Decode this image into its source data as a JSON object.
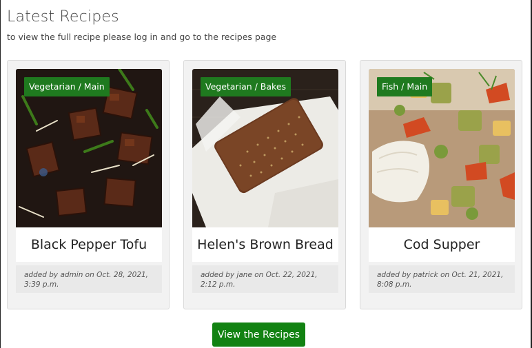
{
  "header": {
    "title": "Latest Recipes",
    "subtitle": "to view the full recipe please log in and go to the recipes page"
  },
  "recipes": [
    {
      "category": "Vegetarian / Main",
      "title": "Black Pepper Tofu",
      "meta": "added by admin on Oct. 28, 2021, 3:39 p.m.",
      "image": "black-pepper-tofu-photo"
    },
    {
      "category": "Vegetarian / Bakes",
      "title": "Helen's Brown Bread",
      "meta": "added by jane on Oct. 22, 2021, 2:12 p.m.",
      "image": "brown-bread-photo"
    },
    {
      "category": "Fish / Main",
      "title": "Cod Supper",
      "meta": "added by patrick on Oct. 21, 2021, 8:08 p.m.",
      "image": "cod-supper-photo"
    }
  ],
  "cta": {
    "label": "View the Recipes"
  },
  "colors": {
    "badge": "#1f7a1f",
    "button": "#128212",
    "card_bg": "#f2f2f2"
  }
}
